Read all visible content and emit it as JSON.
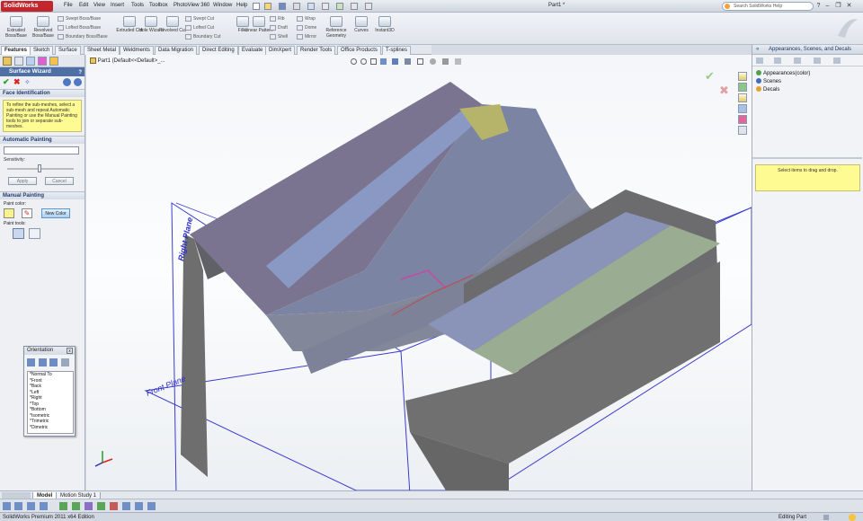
{
  "app": {
    "logo": "SolidWorks",
    "menus": [
      "File",
      "Edit",
      "View",
      "Insert",
      "Tools",
      "Toolbox",
      "PhotoView 360",
      "Window",
      "Help"
    ],
    "doc_title": "Part1 *",
    "search_placeholder": "Search SolidWorks Help",
    "help_label": "?"
  },
  "toolbar": {
    "tools": [
      {
        "label": "Extruded Boss/Base",
        "icon": "extrude-boss-icon"
      },
      {
        "label": "Revolved Boss/Base",
        "icon": "revolve-boss-icon"
      },
      {
        "label": "Extruded Cut",
        "icon": "extrude-cut-icon"
      },
      {
        "label": "Hole Wizard",
        "icon": "hole-wizard-icon"
      },
      {
        "label": "Revolved Cut",
        "icon": "revolve-cut-icon"
      },
      {
        "label": "Fillet",
        "icon": "fillet-icon"
      },
      {
        "label": "Linear Pattern",
        "icon": "linear-pattern-icon"
      },
      {
        "label": "Reference Geometry",
        "icon": "reference-geometry-icon"
      },
      {
        "label": "Curves",
        "icon": "curves-icon"
      },
      {
        "label": "Instant3D",
        "icon": "instant3d-icon"
      }
    ],
    "small_tools_a": [
      "Swept Boss/Base",
      "Lofted Boss/Base",
      "Boundary Boss/Base"
    ],
    "small_tools_b": [
      "Swept Cut",
      "Lofted Cut",
      "Boundary Cut"
    ],
    "small_tools_c": [
      "Rib",
      "Draft",
      "Shell"
    ],
    "small_tools_d": [
      "Wrap",
      "Dome",
      "Mirror"
    ]
  },
  "tabs": [
    "Features",
    "Sketch",
    "Surface",
    "Sheet Metal",
    "Weldments",
    "Data Migration",
    "Direct Editing",
    "Evaluate",
    "DimXpert",
    "Render Tools",
    "Office Products",
    "T-splines"
  ],
  "active_tab": "Features",
  "property_manager": {
    "title": "Surface Wizard",
    "face_identification": {
      "header": "Face Identification",
      "help": "To refine the sub-meshes, select a sub-mesh and repeat Automatic Painting or use the Manual Painting tools to join or separate sub-meshes."
    },
    "automatic_painting": {
      "header": "Automatic Painting",
      "sensitivity_label": "Sensitivity:",
      "apply_label": "Apply",
      "cancel_label": "Cancel"
    },
    "manual_painting": {
      "header": "Manual Painting",
      "paint_color_label": "Paint color:",
      "new_color_label": "New Color",
      "paint_tools_label": "Paint tools:"
    }
  },
  "viewport": {
    "tree_label": "Part1 (Default<<Default>_...",
    "right_plane": "Right Plane",
    "front_plane": "Front Plane"
  },
  "orientation": {
    "title": "Orientation",
    "close": "x",
    "views": [
      "*Normal To",
      "*Front",
      "*Back",
      "*Left",
      "*Right",
      "*Top",
      "*Bottom",
      "*Isometric",
      "*Trimetric",
      "*Dimetric"
    ]
  },
  "right_panel": {
    "title": "Appearances, Scenes, and Decals",
    "items": [
      "Appearances(color)",
      "Scenes",
      "Decals"
    ],
    "drag_hint": "Select items to drag and drop."
  },
  "bottom_tabs": [
    "Model",
    "Motion Study 1"
  ],
  "status": {
    "left": "SolidWorks Premium 2011 x64 Edition",
    "mode": "Editing Part"
  },
  "colors": {
    "accent": "#4f6fa7",
    "highlight": "#fdfb92",
    "logo_red": "#c2272d",
    "paint_color": "#f7f28a"
  }
}
